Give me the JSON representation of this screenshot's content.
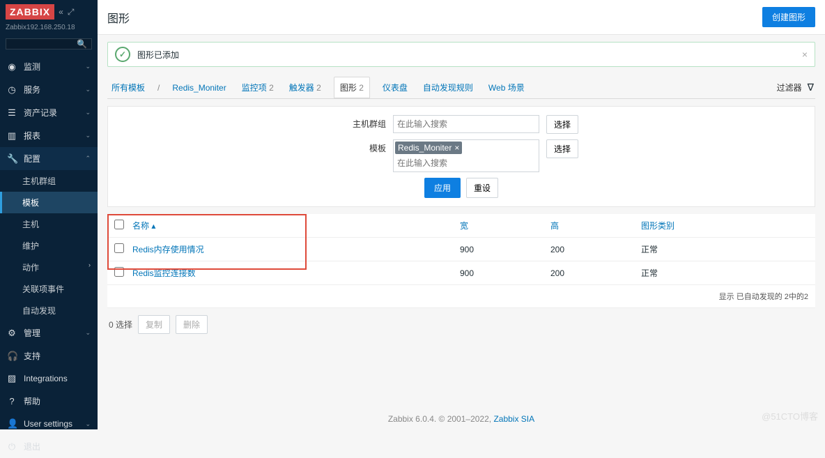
{
  "brand": "ZABBIX",
  "server": "Zabbix192.168.250.18",
  "nav": {
    "monitor": "监测",
    "service": "服务",
    "inventory": "资产记录",
    "reports": "报表",
    "config": "配置",
    "admin": "管理",
    "support": "支持",
    "integrations": "Integrations",
    "help": "帮助",
    "user": "User settings",
    "logout": "退出"
  },
  "config_sub": {
    "hostgroups": "主机群组",
    "templates": "模板",
    "hosts": "主机",
    "maintenance": "维护",
    "actions": "动作",
    "correlation": "关联项事件",
    "discovery": "自动发现"
  },
  "page_title": "图形",
  "create_btn": "创建图形",
  "message": "图形已添加",
  "breadcrumb": {
    "all": "所有模板",
    "tpl": "Redis_Moniter",
    "items": "监控项",
    "items_n": "2",
    "triggers": "触发器",
    "triggers_n": "2",
    "graphs": "图形",
    "graphs_n": "2",
    "dashboards": "仪表盘",
    "discovery": "自动发现规则",
    "web": "Web 场景"
  },
  "filter": {
    "label": "过滤器",
    "hostgroup_lbl": "主机群组",
    "hostgroup_ph": "在此输入搜索",
    "template_lbl": "模板",
    "template_tag": "Redis_Moniter",
    "template_ph": "在此输入搜索",
    "select": "选择",
    "apply": "应用",
    "reset": "重设"
  },
  "table": {
    "col_name": "名称",
    "col_width": "宽",
    "col_height": "高",
    "col_type": "图形类别",
    "rows": [
      {
        "name": "Redis内存使用情况",
        "w": "900",
        "h": "200",
        "type": "正常"
      },
      {
        "name": "Redis监控连接数",
        "w": "900",
        "h": "200",
        "type": "正常"
      }
    ],
    "footer": "显示 已自动发现的 2中的2"
  },
  "selection": {
    "count": "0 选择",
    "copy": "复制",
    "delete": "删除"
  },
  "pagefoot": {
    "text": "Zabbix 6.0.4. © 2001–2022, ",
    "link": "Zabbix SIA"
  },
  "watermark": "@51CTO博客"
}
